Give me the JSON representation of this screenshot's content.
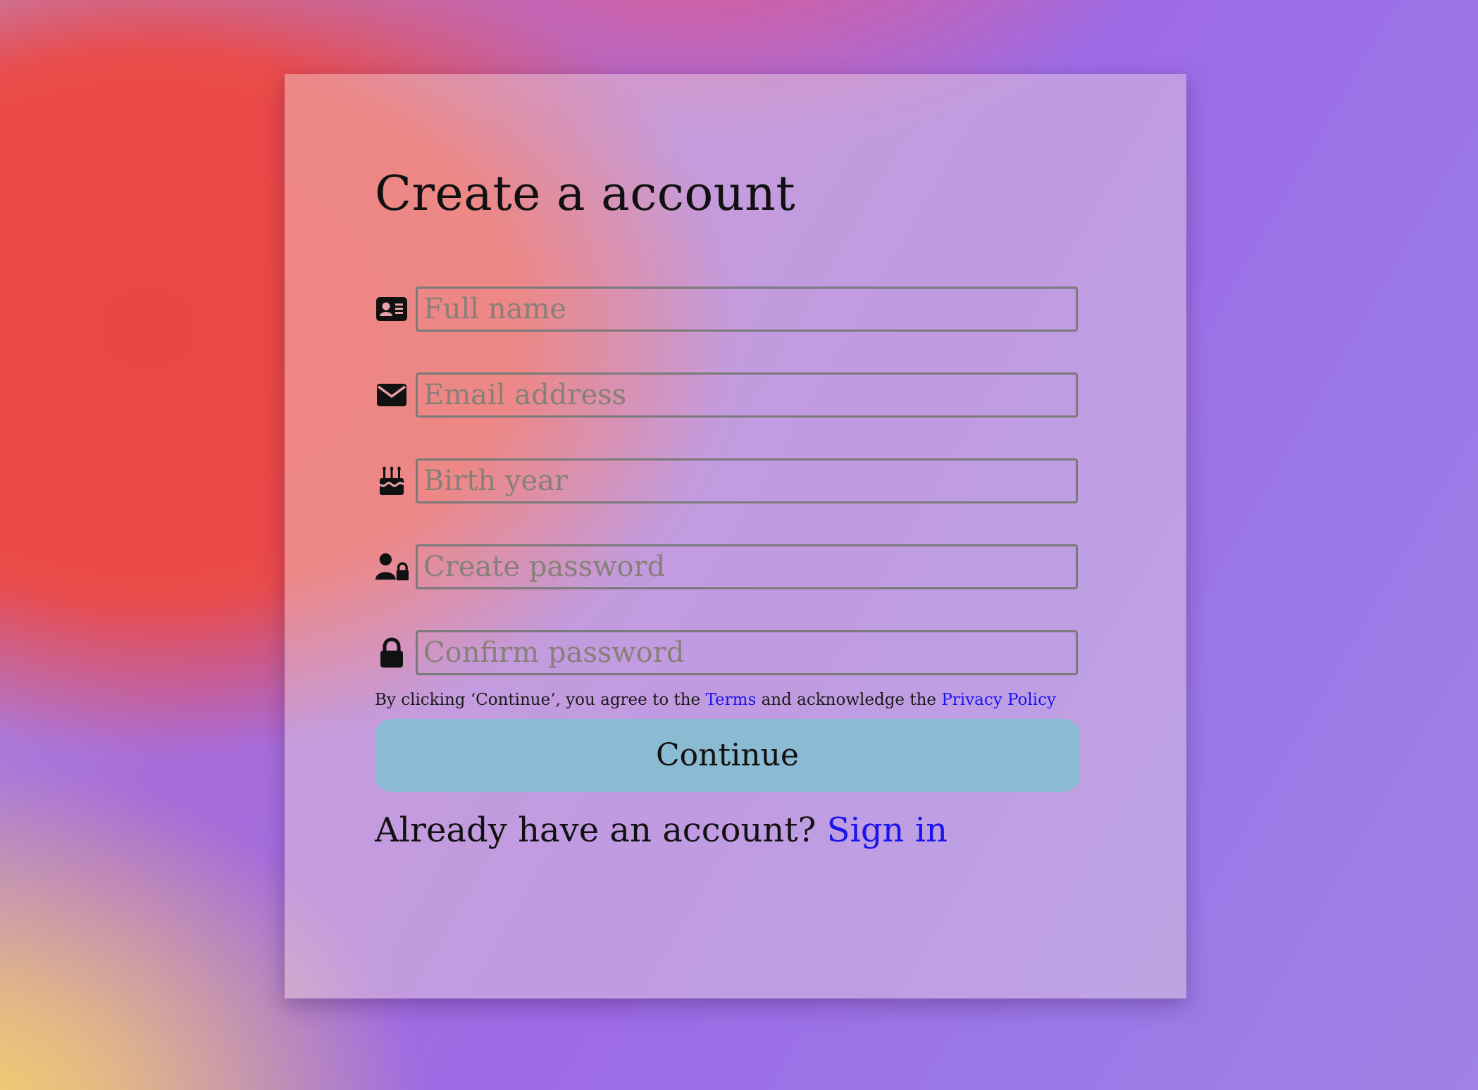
{
  "form": {
    "title": "Create a account",
    "fields": [
      {
        "icon": "id-card-icon",
        "placeholder": "Full name",
        "value": ""
      },
      {
        "icon": "envelope-icon",
        "placeholder": "Email address",
        "value": ""
      },
      {
        "icon": "birthday-cake-icon",
        "placeholder": "Birth year",
        "value": ""
      },
      {
        "icon": "user-lock-icon",
        "placeholder": "Create password",
        "value": ""
      },
      {
        "icon": "lock-icon",
        "placeholder": "Confirm password",
        "value": ""
      }
    ],
    "legal": {
      "prefix": "By clicking ‘Continue’, you agree to the",
      "terms_link": "Terms",
      "middle": "and acknowledge the",
      "privacy_link": "Privacy Policy"
    },
    "continue_label": "Continue",
    "signin_prompt": "Already have an account?",
    "signin_link": "Sign in"
  },
  "colors": {
    "link": "#1a14ee",
    "button": "#8bbbd2",
    "field_border": "#7a7a7a"
  }
}
